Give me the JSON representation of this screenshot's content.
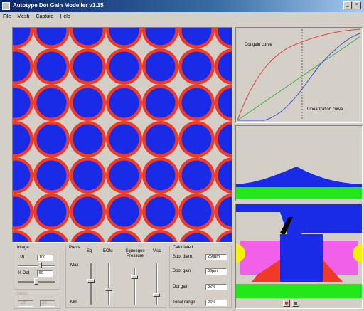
{
  "window": {
    "title": "Autotype Dot Gain Modeller v1.15"
  },
  "menu": [
    "File",
    "Mesh",
    "Capture",
    "Help"
  ],
  "colors": {
    "dot": "#1a2be8",
    "gain": "#f03a28",
    "paper": "#d4cfc6",
    "accent_green": "#22e81a",
    "magenta": "#f060e8",
    "yellow": "#f5f200"
  },
  "image": {
    "title": "Image",
    "lpi_label": "LPI",
    "lpi_value": "100",
    "dot_label": "% Dot",
    "dot_value": "50"
  },
  "ghost": {
    "title": "Mesh",
    "a": "120",
    "b": "34"
  },
  "press": {
    "title": "Press",
    "cols": [
      "Sq",
      "EOM",
      "Squeegee Pressure",
      "Visc"
    ],
    "max_label": "Max",
    "min_label": "Min"
  },
  "calculated": {
    "title": "Calculated",
    "rows": [
      {
        "label": "Spot diam.",
        "value": "250µm"
      },
      {
        "label": "Spot gain",
        "value": "36µm"
      },
      {
        "label": "Dot gain",
        "value": "32%"
      },
      {
        "label": "Tonal range",
        "value": "26%"
      }
    ]
  },
  "curves": {
    "dot_gain_label": "Dot gain curve",
    "linearization_label": "Linearization curve"
  },
  "section": {
    "icons": [
      "record-icon",
      "stop-icon"
    ]
  }
}
